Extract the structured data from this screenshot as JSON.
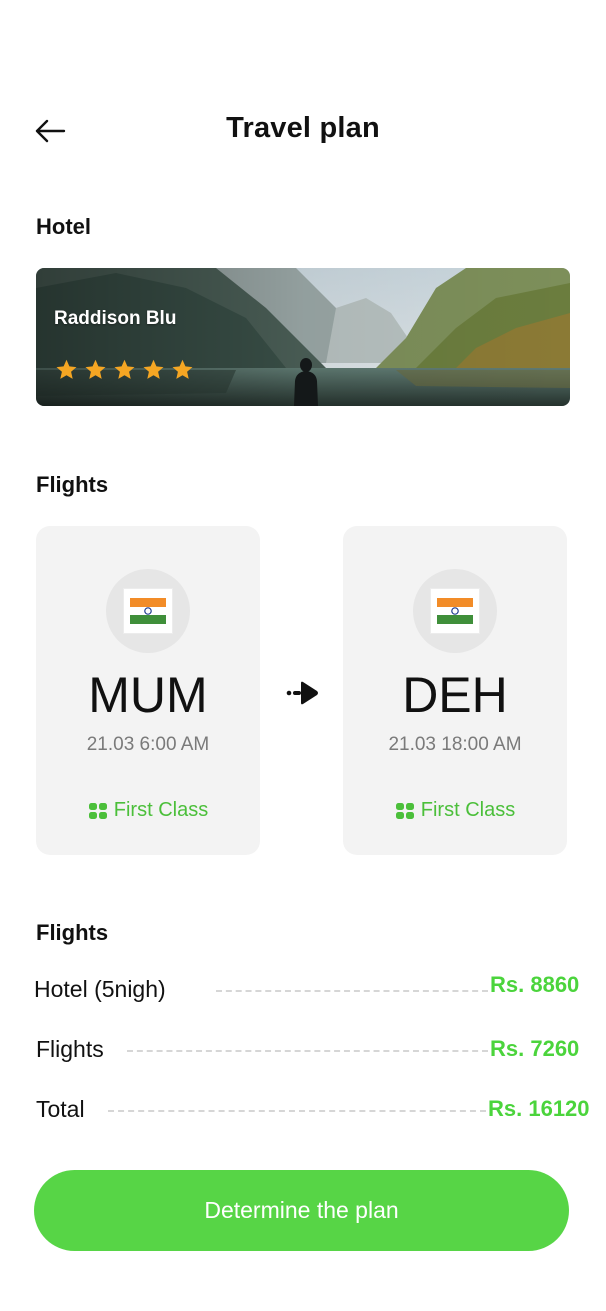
{
  "header": {
    "title": "Travel plan",
    "back_icon": "arrow-left-icon"
  },
  "hotel": {
    "section_label": "Hotel",
    "name": "Raddison Blu",
    "rating": 5,
    "rating_max": 5,
    "star_color": "#F5A623"
  },
  "flights": {
    "section_label": "Flights",
    "origin": {
      "flag": "india-flag-icon",
      "code": "MUM",
      "datetime": "21.03 6:00 AM",
      "class_label": "First Class"
    },
    "destination": {
      "flag": "india-flag-icon",
      "code": "DEH",
      "datetime": "21.03 18:00 AM",
      "class_label": "First Class"
    },
    "direction_icon": "arrow-right-icon"
  },
  "summary": {
    "section_label": "Flights",
    "rows": [
      {
        "label": "Hotel (5nigh)",
        "value": "Rs. 8860"
      },
      {
        "label": "Flights",
        "value": "Rs. 7260"
      },
      {
        "label": "Total",
        "value": "Rs. 16120"
      }
    ]
  },
  "cta": {
    "label": "Determine the plan"
  },
  "colors": {
    "accent": "#57D546",
    "accent_text": "#4BBF3A",
    "card_bg": "#F3F3F3",
    "muted_text": "#7A7A7A"
  }
}
